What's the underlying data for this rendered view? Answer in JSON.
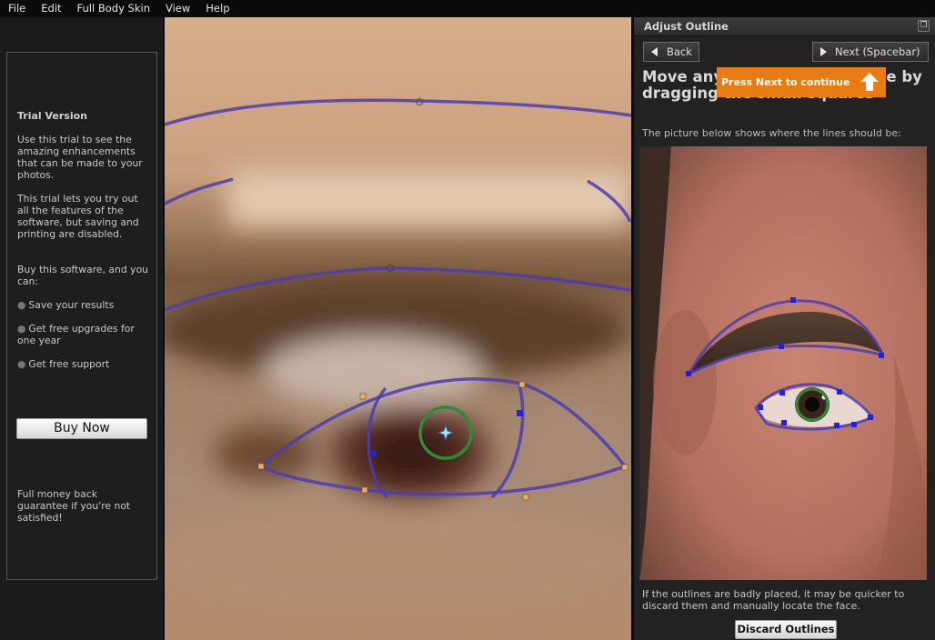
{
  "menu": [
    "File",
    "Edit",
    "Full Body Skin",
    "View",
    "Help"
  ],
  "sidebar": {
    "title": "Trial Version",
    "p1": "Use this trial to see the amazing enhancements that can be made to your photos.",
    "p2": "This trial lets you try out all the features of the software, but saving and printing are disabled.",
    "p3": "Buy this software, and you can:",
    "bullets": [
      "Save your results",
      "Get free upgrades for one year",
      "Get free support"
    ],
    "buy_label": "Buy Now",
    "guarantee": "Full money back guarantee if you're not satisfied!"
  },
  "panel": {
    "title": "Adjust Outline",
    "restore_icon": "restore-icon",
    "back_label": "Back",
    "next_label": "Next (Spacebar)",
    "instruction": "Move any ... ot on the outlin ... y ... gging the small squares",
    "instruction_visible": "Move any point on the outline by dragging the small squares",
    "subtext": "The picture below shows where the lines should be:",
    "tooltip": "Press Next to continue",
    "bottom_text": "If the outlines are badly placed, it may be quicker to discard them and manually locate the face.",
    "discard_label": "Discard Outlines"
  },
  "colors": {
    "outline": "#4b3cb4",
    "handle_orange": "#f0b050",
    "handle_blue": "#2020e0",
    "iris_ring": "#2e8b3a",
    "tooltip_bg": "#e87b12"
  }
}
